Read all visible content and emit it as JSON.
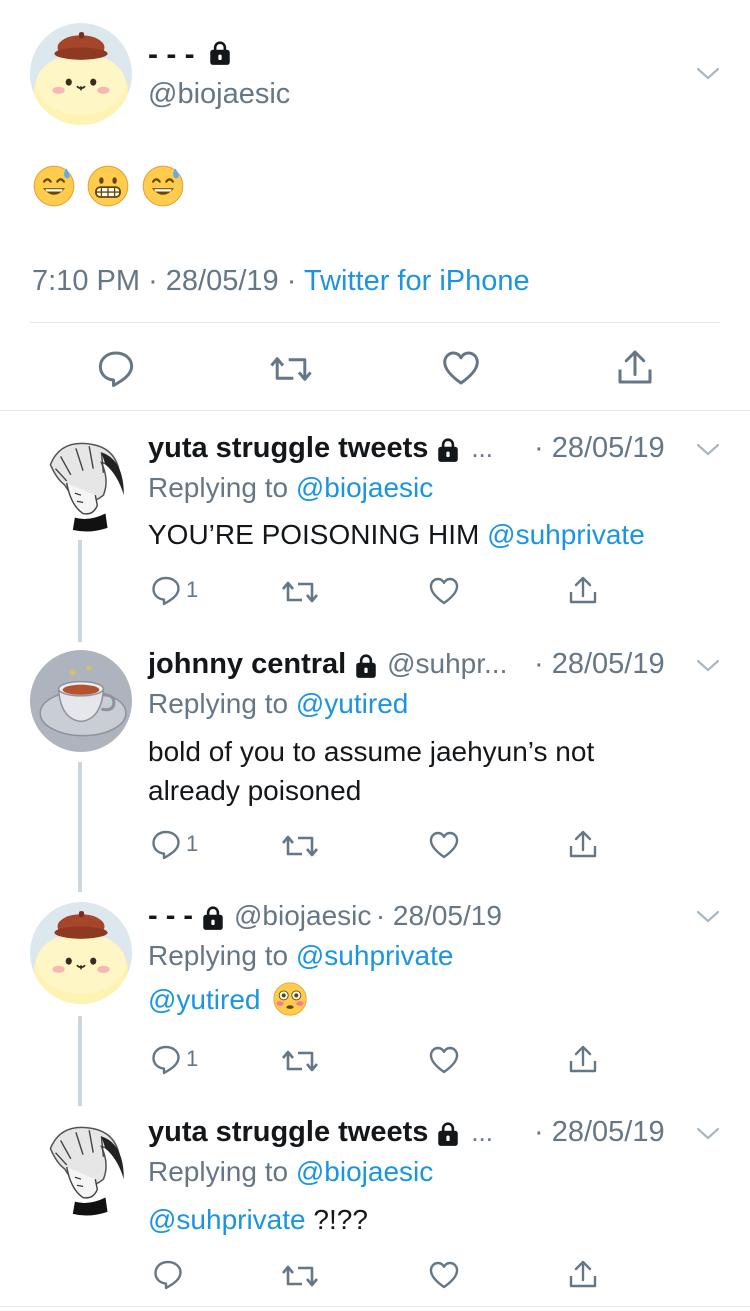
{
  "main_tweet": {
    "display_name": "- - -",
    "handle": "@biojaesic",
    "body_emojis": [
      "grinning-sweat",
      "grimacing",
      "grinning-sweat"
    ],
    "time": "7:10 PM",
    "sep": "·",
    "date": "28/05/19",
    "source": "Twitter for iPhone"
  },
  "replies": [
    {
      "display_name": "yuta struggle tweets",
      "handle": "...",
      "date": "· 28/05/19",
      "replying_prefix": "Replying to",
      "replying_to": "@biojaesic",
      "text": "YOU’RE POISONING HIM",
      "mention": "@suhprivate",
      "reply_count": "1",
      "avatar": "sketch-avatar-icon"
    },
    {
      "display_name": "johnny central",
      "handle": "@suhpr...",
      "date": "· 28/05/19",
      "replying_prefix": "Replying to",
      "replying_to": "@yutired",
      "text_line1": "bold of you to assume jaehyun’s not",
      "text_line2": "already poisoned",
      "reply_count": "1",
      "avatar": "teacup-avatar-icon"
    },
    {
      "display_name": "- - -",
      "handle": "@biojaesic",
      "date": "· 28/05/19",
      "replying_prefix": "Replying to",
      "replying_to": "@suhprivate",
      "mention": "@yutired",
      "reply_count": "1",
      "avatar": "pompompurin-avatar-icon"
    },
    {
      "display_name": "yuta struggle tweets",
      "handle": "...",
      "date": "· 28/05/19",
      "replying_prefix": "Replying to",
      "replying_to": "@biojaesic",
      "mention": "@suhprivate",
      "text_suffix": "?!??",
      "avatar": "sketch-avatar-icon"
    }
  ],
  "colors": {
    "link": "#1b95e0",
    "secondary": "#657786",
    "divider": "#e1e8ed",
    "thread_line": "#ccd6dd"
  }
}
